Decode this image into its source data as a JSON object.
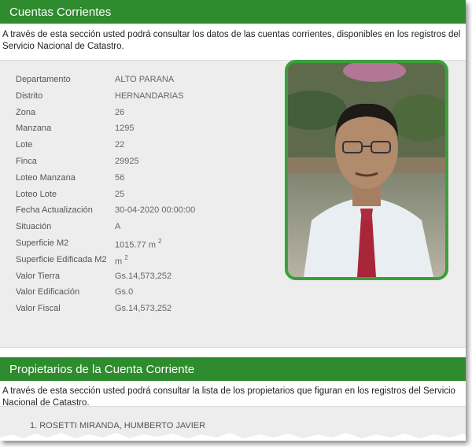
{
  "section1": {
    "title": "Cuentas Corrientes",
    "description": "A través de esta sección usted podrá consultar los datos de las cuentas corrientes, disponibles en los registros del Servicio Nacional de Catastro."
  },
  "details": [
    {
      "label": "Departamento",
      "value": "ALTO PARANA"
    },
    {
      "label": "Distrito",
      "value": "HERNANDARIAS"
    },
    {
      "label": "Zona",
      "value": "26"
    },
    {
      "label": "Manzana",
      "value": "1295"
    },
    {
      "label": "Lote",
      "value": "22"
    },
    {
      "label": "Finca",
      "value": "29925"
    },
    {
      "label": "Loteo Manzana",
      "value": "56"
    },
    {
      "label": "Loteo Lote",
      "value": "25"
    },
    {
      "label": "Fecha Actualización",
      "value": "30-04-2020 00:00:00"
    },
    {
      "label": "Situación",
      "value": "A"
    },
    {
      "label": "Superficie M2",
      "value": "1015.77 m",
      "sup": "2"
    },
    {
      "label": "Superficie Edificada M2",
      "value": "m",
      "sup": "2"
    },
    {
      "label": "Valor Tierra",
      "value": "Gs.14,573,252"
    },
    {
      "label": "Valor Edificación",
      "value": "Gs.0"
    },
    {
      "label": "Valor Fiscal",
      "value": "Gs.14,573,252"
    }
  ],
  "section2": {
    "title": "Propietarios de la Cuenta Corriente",
    "description": "A través de esta sección usted podrá consultar la lista de los propietarios que figuran en los registros del Servicio Nacional de Catastro."
  },
  "owners": [
    "1. ROSETTI MIRANDA, HUMBERTO JAVIER"
  ],
  "colors": {
    "header": "#2e8b2e",
    "photo_border": "#3aa13a",
    "panel": "#ededed"
  }
}
